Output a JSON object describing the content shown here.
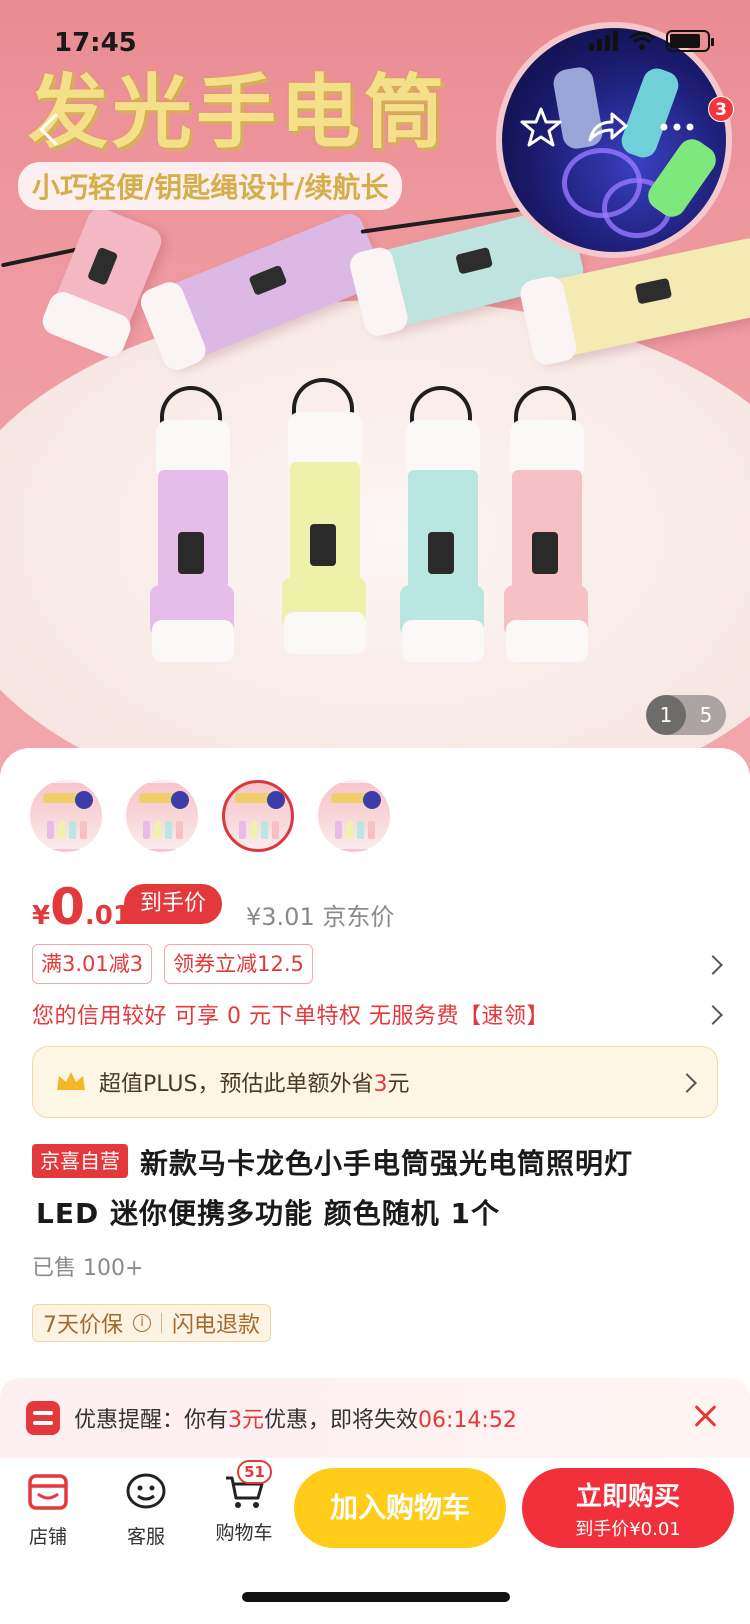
{
  "status_bar": {
    "time": "17:45"
  },
  "hero": {
    "banner_title": "发光手电筒",
    "banner_subtitle": "小巧轻便/钥匙绳设计/续航长",
    "cart_badge": "3",
    "pager_current": "1",
    "pager_total": "5"
  },
  "price": {
    "symbol": "¥",
    "integer": "0",
    "decimal": ".01",
    "tag": "到手价",
    "jd_price": "¥3.01 京东价"
  },
  "coupons": [
    "满3.01减3",
    "领券立减12.5"
  ],
  "credit_text": "您的信用较好 可享 0 元下单特权 无服务费【速领】",
  "plus": {
    "label": "超值PLUS，预估此单额外省",
    "amount": "3",
    "unit": "元"
  },
  "product": {
    "tag": "京喜自营",
    "title_line1": "新款马卡龙色小手电筒强光电筒照明灯",
    "title_line2": "LED 迷你便携多功能 颜色随机 1个",
    "sold": "已售 100+",
    "service_1": "7天价保",
    "service_2": "闪电退款"
  },
  "reminder": {
    "prefix": "优惠提醒：你有",
    "amount": "3元",
    "middle": "优惠，即将失效",
    "countdown": "06:14:52"
  },
  "bottom_bar": {
    "store": "店铺",
    "service": "客服",
    "cart": "购物车",
    "cart_count": "51",
    "add_cart": "加入购物车",
    "buy_now": "立即购买",
    "buy_now_sub": "到手价¥0.01"
  },
  "colors": {
    "accent_red": "#e4393c",
    "cart_yellow": "#ffcc1a",
    "buy_red": "#f2303b"
  }
}
